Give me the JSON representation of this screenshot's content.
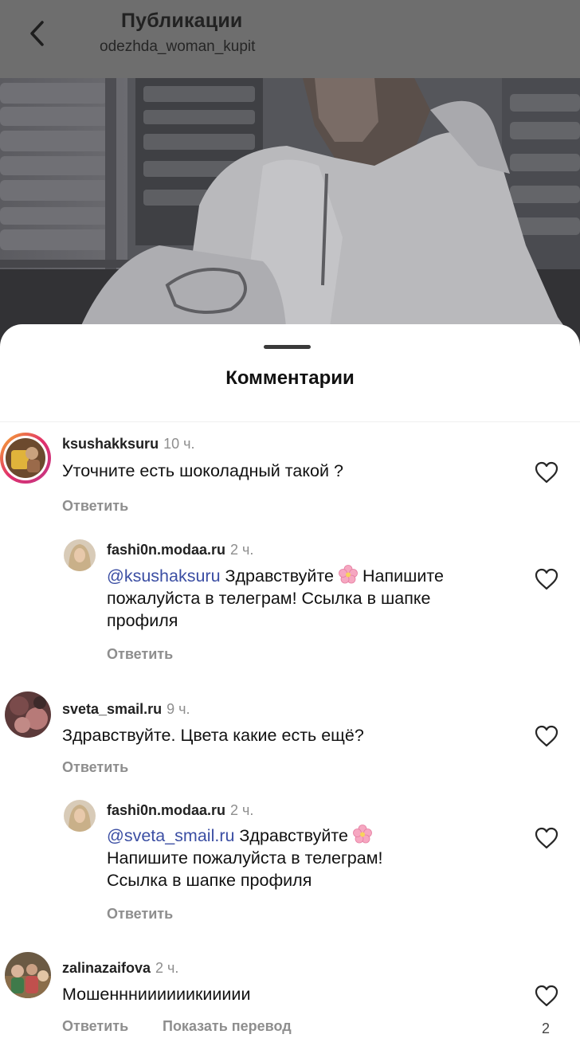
{
  "header": {
    "title": "Публикации",
    "subtitle": "odezhda_woman_kupit"
  },
  "sheet": {
    "title": "Комментарии"
  },
  "comments": [
    {
      "username": "ksushakksuru",
      "time": "10 ч.",
      "text": "Уточните есть шоколадный такой ?",
      "reply_label": "Ответить"
    },
    {
      "username": "fashi0n.modaa.ru",
      "time": "2 ч.",
      "mention": "@ksushaksuru",
      "text_line1": " Здравствуйте ",
      "text_line1b": " Напишите",
      "text_line2": "пожалуйста в телеграм! Ссылка в шапке",
      "text_line3": "профиля",
      "reply_label": "Ответить"
    },
    {
      "username": "sveta_smail.ru",
      "time": "9 ч.",
      "text": "Здравствуйте. Цвета какие есть ещё?",
      "reply_label": "Ответить"
    },
    {
      "username": "fashi0n.modaa.ru",
      "time": "2 ч.",
      "mention": "@sveta_smail.ru",
      "text_line1": " Здравствуйте ",
      "text_line2": "Напишите пожалуйста в телеграм!",
      "text_line3": "Ссылка в шапке профиля",
      "reply_label": "Ответить"
    },
    {
      "username": "zalinazaifova",
      "time": "2 ч.",
      "text": "Мошеннниииииикиииии",
      "reply_label": "Ответить",
      "translate_label": "Показать перевод",
      "likes": "2"
    }
  ],
  "icons": {
    "back": "chevron-left-icon",
    "heart": "heart-outline-icon",
    "flower": "cherry-blossom-emoji"
  },
  "colors": {
    "mention": "#3b4ea3",
    "secondary_text": "#8e8e8e"
  }
}
